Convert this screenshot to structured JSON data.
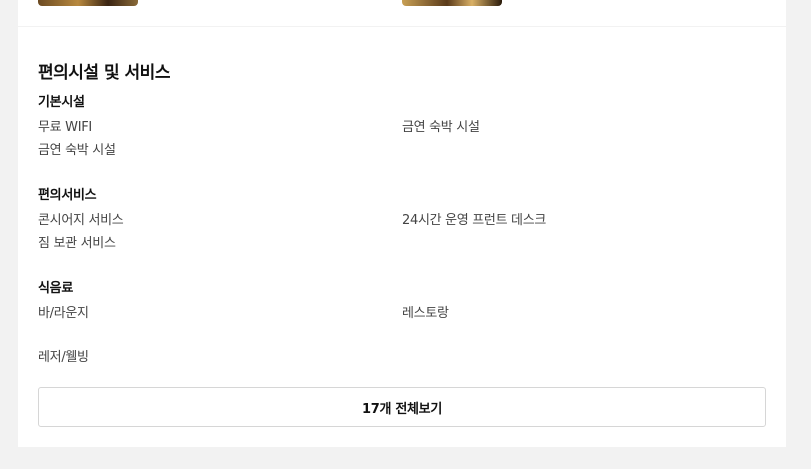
{
  "amenities": {
    "title": "편의시설 및 서비스",
    "groups": [
      {
        "title": "기본시설",
        "items": [
          "무료 WIFI",
          "금연 숙박 시설",
          "금연 숙박 시설"
        ]
      },
      {
        "title": "편의서비스",
        "items": [
          "콘시어지 서비스",
          "24시간 운영 프런트 데스크",
          "짐 보관 서비스"
        ]
      },
      {
        "title": "식음료",
        "items": [
          "바/라운지",
          "레스토랑"
        ]
      }
    ],
    "extra_category": "레저/웰빙",
    "view_all_label": "17개 전체보기"
  }
}
